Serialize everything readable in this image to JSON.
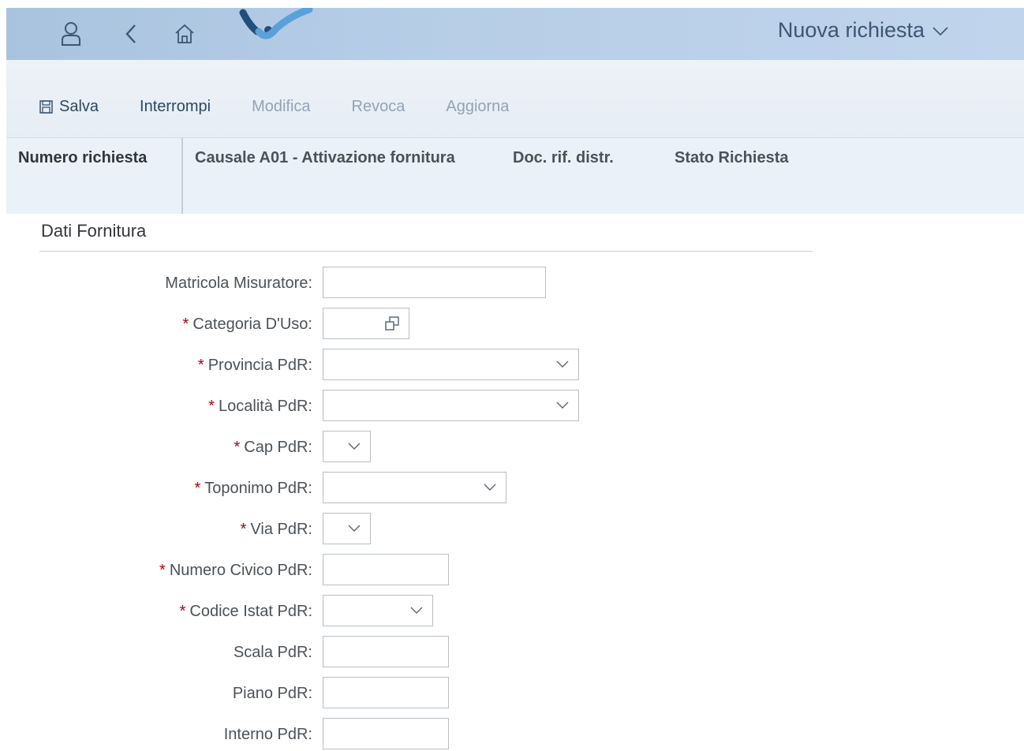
{
  "shell": {
    "title": "Nuova richiesta",
    "icons": [
      "user-icon",
      "back-icon",
      "home-icon"
    ],
    "logo": "company-logo",
    "colors": {
      "shellbar": "#b6cde6",
      "title": "#3d5671",
      "logo_dark": "#1f4f7a",
      "logo_light": "#5aa0d9"
    }
  },
  "toolbar": {
    "save_label": "Salva",
    "interrupt_label": "Interrompi",
    "edit_label": "Modifica",
    "revoke_label": "Revoca",
    "refresh_label": "Aggiorna"
  },
  "object_header": {
    "request_number_label": "Numero richiesta",
    "reason_label": "Causale A01 - Attivazione fornitura",
    "distributor_doc_label": "Doc. rif. distr.",
    "status_label": "Stato Richiesta"
  },
  "section": {
    "title": "Dati Fornitura"
  },
  "form": {
    "fields": [
      {
        "label": "Matricola Misuratore:",
        "required": false,
        "type": "input",
        "value": ""
      },
      {
        "label": "Categoria D'Uso:",
        "required": true,
        "type": "valuehelp",
        "value": ""
      },
      {
        "label": "Provincia PdR:",
        "required": true,
        "type": "select",
        "value": ""
      },
      {
        "label": "Località PdR:",
        "required": true,
        "type": "select",
        "value": ""
      },
      {
        "label": "Cap PdR:",
        "required": true,
        "type": "select",
        "value": ""
      },
      {
        "label": "Toponimo PdR:",
        "required": true,
        "type": "select",
        "value": ""
      },
      {
        "label": "Via PdR:",
        "required": true,
        "type": "select",
        "value": ""
      },
      {
        "label": "Numero Civico PdR:",
        "required": true,
        "type": "input",
        "value": ""
      },
      {
        "label": "Codice Istat PdR:",
        "required": true,
        "type": "select",
        "value": ""
      },
      {
        "label": "Scala PdR:",
        "required": false,
        "type": "input",
        "value": ""
      },
      {
        "label": "Piano PdR:",
        "required": false,
        "type": "input",
        "value": ""
      },
      {
        "label": "Interno PdR:",
        "required": false,
        "type": "input",
        "value": ""
      }
    ],
    "required_marker": "*"
  }
}
